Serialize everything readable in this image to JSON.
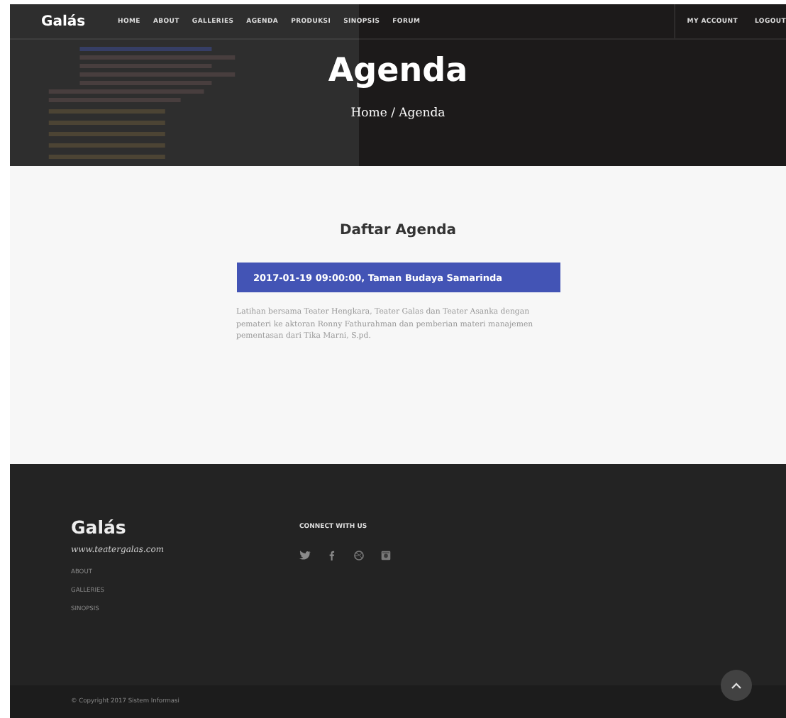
{
  "header": {
    "logo": "Galás",
    "nav": [
      "HOME",
      "ABOUT",
      "GALLERIES",
      "AGENDA",
      "PRODUKSI",
      "SINOPSIS",
      "FORUM"
    ],
    "account_links": [
      "MY ACCOUNT",
      "LOGOUT"
    ],
    "title": "Agenda",
    "breadcrumb": "Home / Agenda"
  },
  "content": {
    "heading": "Daftar Agenda",
    "events": [
      {
        "title": "2017-01-19 09:00:00, Taman Budaya Samarinda",
        "description": "Latihan bersama Teater Hengkara, Teater Galas dan Teater Asanka dengan pemateri ke aktoran Ronny Fathurahman dan pemberian materi manajemen pementasan dari Tika Marni, S.pd."
      }
    ]
  },
  "footer": {
    "logo": "Galás",
    "url": "www.teatergalas.com",
    "links": [
      "ABOUT",
      "GALLERIES",
      "SINOPSIS"
    ],
    "connect_heading": "CONNECT WITH US",
    "social": [
      {
        "kind": "twitter"
      },
      {
        "kind": "facebook"
      },
      {
        "kind": "dribbble"
      },
      {
        "kind": "instagram"
      }
    ],
    "copyright": "© Copyright 2017 Sistem Informasi"
  }
}
